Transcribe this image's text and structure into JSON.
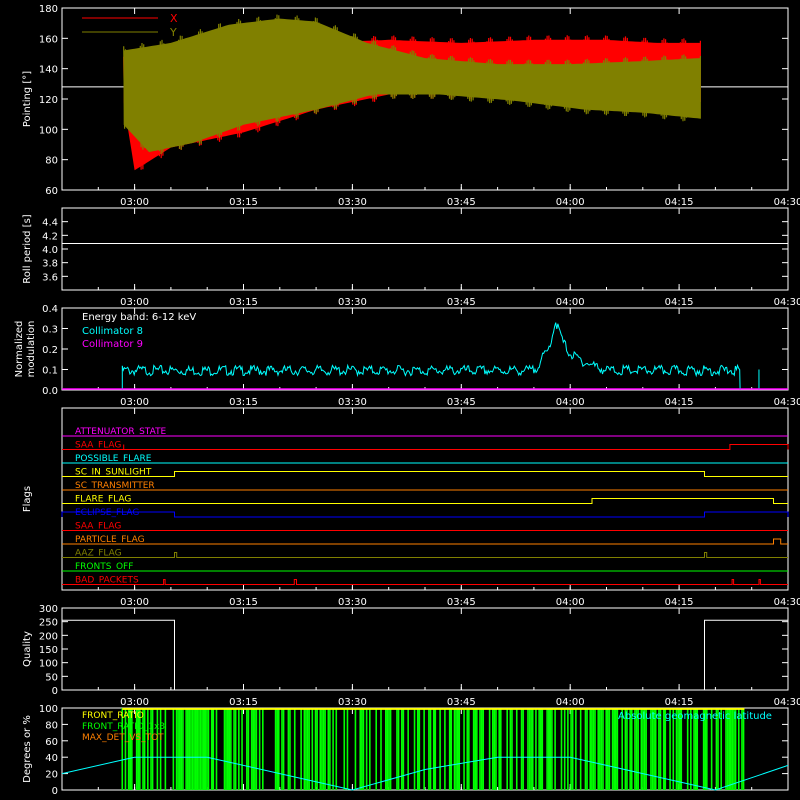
{
  "chart_data": [
    {
      "type": "line",
      "ylabel": "Pointing [°]",
      "ylim": [
        60,
        180
      ],
      "y_ticks": [
        "60",
        "80",
        "100",
        "120",
        "140",
        "160",
        "180"
      ],
      "x_range_minutes": [
        170,
        270
      ],
      "x_tick_minutes": [
        180,
        195,
        210,
        225,
        240,
        255,
        270
      ],
      "x_ticks": [
        "03:00",
        "03:15",
        "03:30",
        "03:45",
        "04:00",
        "04:15",
        "04:30"
      ],
      "legend": "top-left",
      "reference_line": 128,
      "series": [
        {
          "name": "X",
          "color": "#ff0000",
          "upper": [
            [
              178.5,
              148
            ],
            [
              185,
              150
            ],
            [
              195,
              158
            ],
            [
              205,
              160
            ],
            [
              215,
              162
            ],
            [
              225,
              160
            ],
            [
              235,
              162
            ],
            [
              245,
              162
            ],
            [
              252,
              160
            ],
            [
              258,
              160
            ]
          ],
          "lower": [
            [
              178.5,
              115
            ],
            [
              180,
              70
            ],
            [
              185,
              85
            ],
            [
              195,
              95
            ],
            [
              205,
              110
            ],
            [
              215,
              120
            ],
            [
              225,
              120
            ],
            [
              235,
              118
            ],
            [
              245,
              118
            ],
            [
              252,
              118
            ],
            [
              258,
              115
            ]
          ]
        },
        {
          "name": "Y",
          "color": "#808000",
          "upper": [
            [
              178.5,
              155
            ],
            [
              185,
              160
            ],
            [
              193,
              172
            ],
            [
              200,
              176
            ],
            [
              205,
              174
            ],
            [
              212,
              160
            ],
            [
              220,
              150
            ],
            [
              230,
              146
            ],
            [
              240,
              146
            ],
            [
              250,
              148
            ],
            [
              258,
              150
            ]
          ],
          "lower": [
            [
              178.5,
              100
            ],
            [
              182,
              82
            ],
            [
              188,
              88
            ],
            [
              195,
              100
            ],
            [
              205,
              110
            ],
            [
              213,
              120
            ],
            [
              222,
              120
            ],
            [
              232,
              116
            ],
            [
              242,
              110
            ],
            [
              250,
              108
            ],
            [
              258,
              104
            ]
          ]
        }
      ]
    },
    {
      "type": "line",
      "ylabel": "Roll period [s]",
      "ylim": [
        3.4,
        4.6
      ],
      "y_ticks": [
        "3.6",
        "3.8",
        "4.0",
        "4.2",
        "4.4"
      ],
      "x_ticks": [
        "03:00",
        "03:15",
        "03:30",
        "03:45",
        "04:00",
        "04:15",
        "04:30"
      ],
      "series": [
        {
          "name": "",
          "color": "#ffffff",
          "x": [
            170,
            270
          ],
          "y": [
            4.08,
            4.08
          ]
        }
      ]
    },
    {
      "type": "line",
      "ylabel": "Normalized modulation",
      "ylim": [
        0,
        0.4
      ],
      "y_ticks": [
        "0.0",
        "0.1",
        "0.2",
        "0.3",
        "0.4"
      ],
      "x_ticks": [
        "03:00",
        "03:15",
        "03:30",
        "03:45",
        "04:00",
        "04:15",
        "04:30"
      ],
      "legend": "top-left",
      "annotation": "Energy band: 6-12 keV",
      "series": [
        {
          "name": "Collimator 8",
          "color": "#00ffff",
          "x": [
            178.3,
            180,
            200,
            220,
            235,
            237,
            238,
            239,
            240,
            242,
            245,
            250,
            255,
            258,
            260,
            263.4
          ],
          "y": [
            0.1,
            0.1,
            0.1,
            0.1,
            0.1,
            0.2,
            0.34,
            0.24,
            0.18,
            0.14,
            0.1,
            0.1,
            0.1,
            0.1,
            0.1,
            0.1
          ]
        },
        {
          "name": "Collimator 9",
          "color": "#ff00ff",
          "x": [
            170,
            270
          ],
          "y": [
            0,
            0
          ]
        }
      ]
    },
    {
      "type": "line",
      "ylabel": "Flags",
      "x_ticks": [
        "03:00",
        "03:15",
        "03:30",
        "03:45",
        "04:00",
        "04:15",
        "04:30"
      ],
      "flags": [
        {
          "label": "ATTENUATOR_STATE",
          "color": "#ff00ff",
          "segments": []
        },
        {
          "label": "SAA_FLAG",
          "color": "#ff0000",
          "segments": [
            [
              178.5,
              178.5
            ],
            [
              262,
              270
            ]
          ]
        },
        {
          "label": "POSSIBLE_FLARE",
          "color": "#00ffff",
          "segments": []
        },
        {
          "label": "SC_IN_SUNLIGHT",
          "color": "#ffff00",
          "segments": [
            [
              185.5,
              258.5
            ]
          ]
        },
        {
          "label": "SC_TRANSMITTER",
          "color": "#ff8000",
          "segments": []
        },
        {
          "label": "FLARE_FLAG",
          "color": "#ffff00",
          "segments": [
            [
              243,
              268
            ]
          ]
        },
        {
          "label": "ECLIPSE_FLAG",
          "color": "#0000ff",
          "segments": [
            [
              170,
              185.5
            ],
            [
              258.5,
              270
            ]
          ]
        },
        {
          "label": "SAA_FLAG",
          "color": "#ff0000",
          "segments": []
        },
        {
          "label": "PARTICLE_FLAG",
          "color": "#ff8000",
          "segments": [
            [
              268,
              269
            ]
          ]
        },
        {
          "label": "AAZ_FLAG",
          "color": "#808000",
          "segments": [
            [
              185.5,
              185.8
            ],
            [
              258.5,
              258.8
            ]
          ]
        },
        {
          "label": "FRONTS_OFF",
          "color": "#00ff00",
          "segments": []
        },
        {
          "label": "BAD_PACKETS",
          "color": "#ff0000",
          "segments": [
            [
              184,
              184.2
            ],
            [
              202,
              202.3
            ],
            [
              262.3,
              262.5
            ],
            [
              266,
              266.2
            ]
          ]
        }
      ]
    },
    {
      "type": "line",
      "ylabel": "Quality",
      "ylim": [
        0,
        300
      ],
      "y_ticks": [
        "0",
        "50",
        "100",
        "150",
        "200",
        "250",
        "300"
      ],
      "x_ticks": [
        "03:00",
        "03:15",
        "03:30",
        "03:45",
        "04:00",
        "04:15",
        "04:30"
      ],
      "series": [
        {
          "name": "",
          "color": "#ffffff",
          "x": [
            170,
            185.5,
            185.5,
            258.5,
            258.5,
            270
          ],
          "y": [
            255,
            255,
            0,
            0,
            255,
            255
          ]
        }
      ]
    },
    {
      "type": "line",
      "ylabel": "Degrees or %",
      "ylim": [
        0,
        100
      ],
      "y_ticks": [
        "0",
        "20",
        "40",
        "60",
        "80",
        "100"
      ],
      "legend": "top-left",
      "series": [
        {
          "name": "FRONT_RATIO",
          "color": "#ffff00"
        },
        {
          "name": "FRONT_RATIO_1x3",
          "color": "#00ff00",
          "x_range": [
            178.3,
            264
          ]
        },
        {
          "name": "MAX_DET_VS_TOT",
          "color": "#ff8000"
        },
        {
          "name": "Absolute geomagnetic latitude",
          "color": "#00ffff",
          "x": [
            170,
            180,
            190,
            200,
            210,
            220,
            230,
            240,
            250,
            260,
            270
          ],
          "y": [
            20,
            40,
            40,
            20,
            0,
            25,
            40,
            40,
            20,
            0,
            30
          ]
        }
      ]
    }
  ]
}
